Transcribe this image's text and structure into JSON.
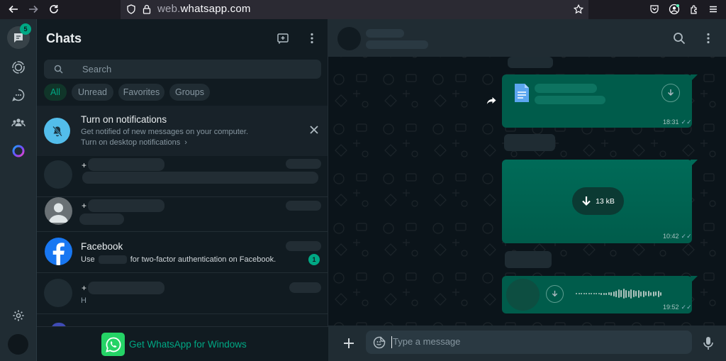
{
  "browser": {
    "url_domain_prefix": "web.",
    "url_domain_main": "whatsapp.com"
  },
  "rail": {
    "chats_badge": "5"
  },
  "chatlist": {
    "title": "Chats",
    "search_placeholder": "Search",
    "filters": [
      "All",
      "Unread",
      "Favorites",
      "Groups"
    ],
    "notification": {
      "title": "Turn on notifications",
      "subtitle": "Get notified of new messages on your computer.",
      "link": "Turn on desktop notifications"
    },
    "rows": [
      {
        "name_prefix": "+",
        "preview": ""
      },
      {
        "name_prefix": "+",
        "preview": ""
      },
      {
        "name": "Facebook",
        "preview_start": "Use",
        "preview_end": "for two-factor authentication on Facebook.",
        "unread": "1"
      },
      {
        "name_prefix": "+",
        "preview": "H"
      }
    ],
    "footer_text": "Get WhatsApp for Windows"
  },
  "conversation": {
    "messages": [
      {
        "type": "document",
        "time": "18:31"
      },
      {
        "type": "image",
        "size": "13 kB",
        "time": "10:42"
      },
      {
        "type": "voice",
        "time": "19:52"
      }
    ],
    "composer_placeholder": "Type a message"
  },
  "colors": {
    "accent": "#00a884",
    "bubble_out": "#005c4b",
    "panel": "#111b21",
    "header": "#202c33"
  }
}
